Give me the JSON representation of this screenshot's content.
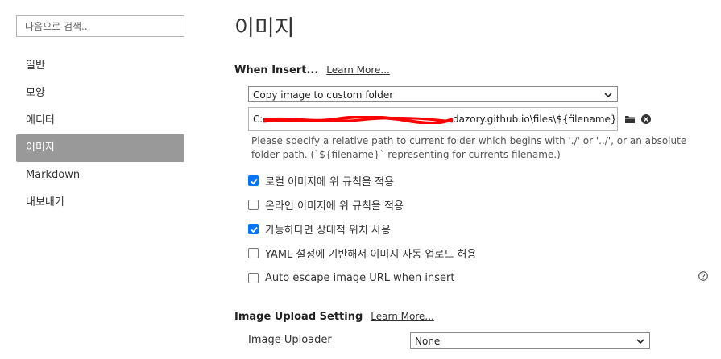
{
  "sidebar": {
    "search_placeholder": "다음으로 검색...",
    "items": [
      {
        "label": "일반"
      },
      {
        "label": "모양"
      },
      {
        "label": "에디터"
      },
      {
        "label": "이미지"
      },
      {
        "label": "Markdown"
      },
      {
        "label": "내보내기"
      }
    ],
    "active_index": 3,
    "active_color": "#999999"
  },
  "main": {
    "title": "이미지",
    "when_insert": {
      "heading": "When Insert...",
      "learn_more": "Learn More...",
      "action_select": "Copy image to custom folder",
      "path_value_visible_suffix": "dazory.github.io\\files\\${filename}",
      "path_prefix_visible": "C:",
      "folder_icon": "folder-icon",
      "clear_icon": "close-circle-icon",
      "hint": "Please specify a relative path to current folder which begins with './' or '../', or an absolute folder path. (`${filename}` representing for currents filename.)"
    },
    "options": [
      {
        "label": "로컬 이미지에 위 규칙을 적용",
        "checked": true
      },
      {
        "label": "온라인 이미지에 위 규칙을 적용",
        "checked": false
      },
      {
        "label": "가능하다면 상대적 위치 사용",
        "checked": true
      },
      {
        "label": "YAML 설정에 기반해서 이미지 자동 업로드 허용",
        "checked": false
      },
      {
        "label": "Auto escape image URL when insert",
        "checked": false
      }
    ],
    "upload": {
      "heading": "Image Upload Setting",
      "learn_more": "Learn More...",
      "uploader_label": "Image Uploader",
      "uploader_value": "None"
    },
    "checkbox_color": "#0075ff",
    "redaction_color": "#ff0000"
  }
}
